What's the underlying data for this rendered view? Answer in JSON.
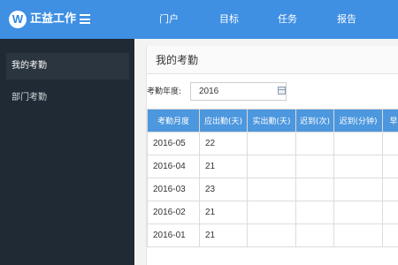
{
  "header": {
    "logo_letter": "W",
    "brand": "正益工作",
    "nav": [
      "门户",
      "目标",
      "任务",
      "报告"
    ]
  },
  "sidebar": {
    "items": [
      {
        "label": "我的考勤"
      },
      {
        "label": "部门考勤"
      }
    ]
  },
  "main": {
    "title": "我的考勤",
    "year_label": "考勤年度:",
    "year_value": "2016",
    "table": {
      "headers": [
        "考勤月度",
        "应出勤(天)",
        "实出勤(天)",
        "迟到(次)",
        "迟到(分钟)",
        "早退"
      ],
      "rows": [
        [
          "2016-05",
          "22",
          "",
          "",
          "",
          ""
        ],
        [
          "2016-04",
          "21",
          "",
          "",
          "",
          ""
        ],
        [
          "2016-03",
          "23",
          "",
          "",
          "",
          ""
        ],
        [
          "2016-02",
          "21",
          "",
          "",
          "",
          ""
        ],
        [
          "2016-01",
          "21",
          "",
          "",
          "",
          ""
        ]
      ]
    }
  },
  "colors": {
    "topbar": "#3f8fe3",
    "sidebar": "#1f2a34",
    "table_header": "#4c97de"
  }
}
